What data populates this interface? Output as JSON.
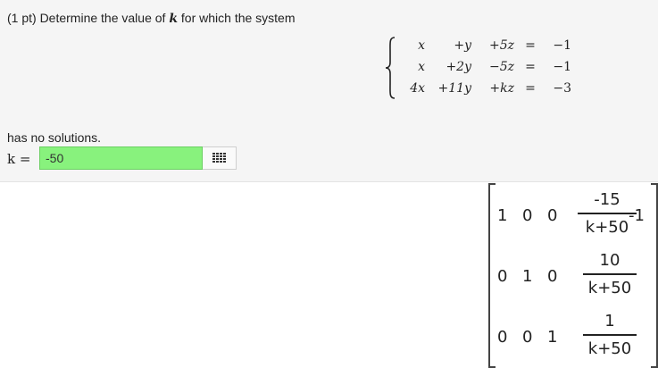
{
  "question": {
    "prefix": "(1 pt) Determine the value of",
    "var": "k",
    "suffix": "for which the system"
  },
  "system": {
    "rows": [
      {
        "c1": "x",
        "c2": "+y",
        "c3": "+5z",
        "eq": "=",
        "rhs": "−1"
      },
      {
        "c1": "x",
        "c2": "+2y",
        "c3": "−5z",
        "eq": "=",
        "rhs": "−1"
      },
      {
        "c1": "4x",
        "c2": "+11y",
        "c3": "+kz",
        "eq": "=",
        "rhs": "−3"
      }
    ]
  },
  "no_solutions_text": "has no solutions.",
  "answer": {
    "label": "k =",
    "value": "-50"
  },
  "matrix": {
    "rows": [
      {
        "a": "1",
        "b": "0",
        "c": "0",
        "num": "-15",
        "den": "k+50",
        "tail": "-1"
      },
      {
        "a": "0",
        "b": "1",
        "c": "0",
        "num": "10",
        "den": "k+50",
        "tail": ""
      },
      {
        "a": "0",
        "b": "0",
        "c": "1",
        "num": "1",
        "den": "k+50",
        "tail": ""
      }
    ]
  },
  "icons": {
    "keypad": "keypad-icon"
  }
}
